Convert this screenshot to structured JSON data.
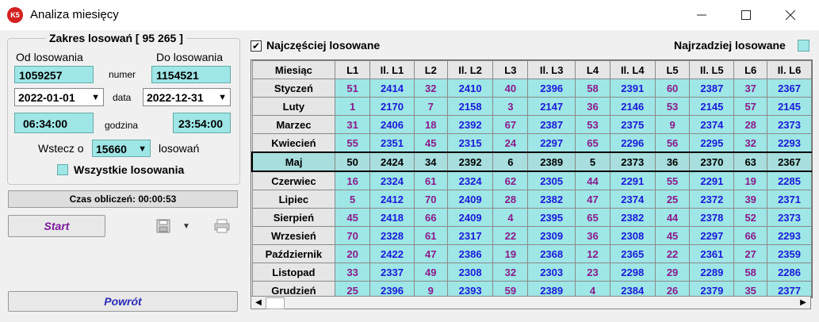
{
  "window": {
    "title": "Analiza miesięcy",
    "icon_text": "K5"
  },
  "left": {
    "group_title": "Zakres losowań  [ 95 265 ]",
    "from_label": "Od losowania",
    "to_label": "Do losowania",
    "from_number": "1059257",
    "to_number": "1154521",
    "numer_label": "numer",
    "from_date": "2022-01-01",
    "to_date": "2022-12-31",
    "data_label": "data",
    "from_time": "06:34:00",
    "to_time": "23:54:00",
    "godzina_label": "godzina",
    "back_label": "Wstecz o",
    "back_value": "15660",
    "back_suffix": "losowań",
    "all_label": "Wszystkie losowania",
    "calc_time": "Czas obliczeń: 00:00:53",
    "start_label": "Start",
    "return_label": "Powrót"
  },
  "right": {
    "most_label": "Najczęściej losowane",
    "least_label": "Najrzadziej losowane"
  },
  "table": {
    "headers": [
      "Miesiąc",
      "L1",
      "Il. L1",
      "L2",
      "Il. L2",
      "L3",
      "Il. L3",
      "L4",
      "Il. L4",
      "L5",
      "Il. L5",
      "L6",
      "Il. L6"
    ],
    "rows": [
      [
        "Styczeń",
        "51",
        "2414",
        "32",
        "2410",
        "40",
        "2396",
        "58",
        "2391",
        "60",
        "2387",
        "37",
        "2367"
      ],
      [
        "Luty",
        "1",
        "2170",
        "7",
        "2158",
        "3",
        "2147",
        "36",
        "2146",
        "53",
        "2145",
        "57",
        "2145"
      ],
      [
        "Marzec",
        "31",
        "2406",
        "18",
        "2392",
        "67",
        "2387",
        "53",
        "2375",
        "9",
        "2374",
        "28",
        "2373"
      ],
      [
        "Kwiecień",
        "55",
        "2351",
        "45",
        "2315",
        "24",
        "2297",
        "65",
        "2296",
        "56",
        "2295",
        "32",
        "2293"
      ],
      [
        "Maj",
        "50",
        "2424",
        "34",
        "2392",
        "6",
        "2389",
        "5",
        "2373",
        "36",
        "2370",
        "63",
        "2367"
      ],
      [
        "Czerwiec",
        "16",
        "2324",
        "61",
        "2324",
        "62",
        "2305",
        "44",
        "2291",
        "55",
        "2291",
        "19",
        "2285"
      ],
      [
        "Lipiec",
        "5",
        "2412",
        "70",
        "2409",
        "28",
        "2382",
        "47",
        "2374",
        "25",
        "2372",
        "39",
        "2371"
      ],
      [
        "Sierpień",
        "45",
        "2418",
        "66",
        "2409",
        "4",
        "2395",
        "65",
        "2382",
        "44",
        "2378",
        "52",
        "2373"
      ],
      [
        "Wrzesień",
        "70",
        "2328",
        "61",
        "2317",
        "22",
        "2309",
        "36",
        "2308",
        "45",
        "2297",
        "66",
        "2293"
      ],
      [
        "Październik",
        "20",
        "2422",
        "47",
        "2386",
        "19",
        "2368",
        "12",
        "2365",
        "22",
        "2361",
        "27",
        "2359"
      ],
      [
        "Listopad",
        "33",
        "2337",
        "49",
        "2308",
        "32",
        "2303",
        "23",
        "2298",
        "29",
        "2289",
        "58",
        "2286"
      ],
      [
        "Grudzień",
        "25",
        "2396",
        "9",
        "2393",
        "59",
        "2389",
        "4",
        "2384",
        "26",
        "2379",
        "35",
        "2377"
      ]
    ],
    "selected_row": 4
  }
}
